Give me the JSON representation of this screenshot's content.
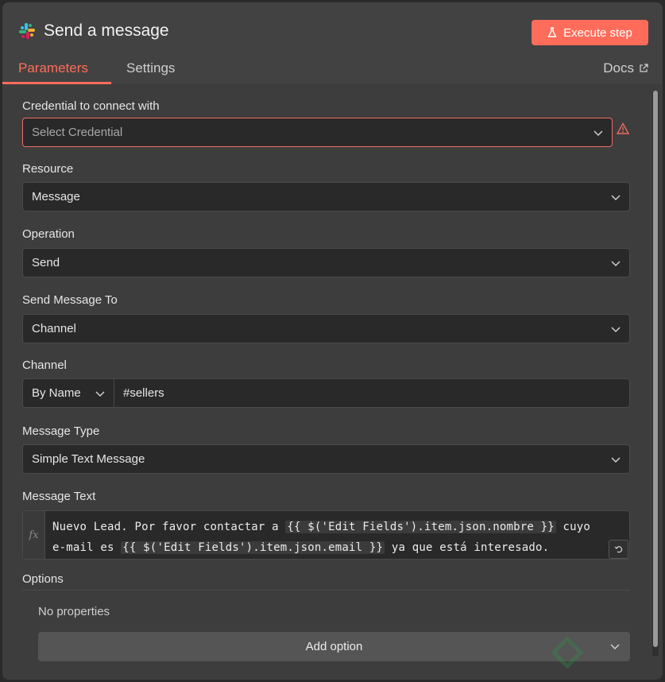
{
  "header": {
    "title": "Send a message",
    "execute_label": "Execute step",
    "tabs": [
      {
        "label": "Parameters",
        "active": true
      },
      {
        "label": "Settings",
        "active": false
      }
    ],
    "docs_label": "Docs"
  },
  "form": {
    "credential": {
      "label": "Credential to connect with",
      "placeholder": "Select Credential"
    },
    "resource": {
      "label": "Resource",
      "value": "Message"
    },
    "operation": {
      "label": "Operation",
      "value": "Send"
    },
    "send_to": {
      "label": "Send Message To",
      "value": "Channel"
    },
    "channel": {
      "label": "Channel",
      "mode": "By Name",
      "value": "#sellers"
    },
    "message_type": {
      "label": "Message Type",
      "value": "Simple Text Message"
    },
    "message_text": {
      "label": "Message Text",
      "fx": "fx",
      "line1_prefix": "Nuevo Lead. Por favor contactar a ",
      "line1_expr": "{{ $('Edit Fields').item.json.nombre }}",
      "line1_suffix": " cuyo",
      "line2_prefix": "e-mail es ",
      "line2_expr": "{{ $('Edit Fields').item.json.email }}",
      "line2_suffix": " ya que está interesado."
    },
    "options": {
      "label": "Options",
      "empty_text": "No properties",
      "add_label": "Add option"
    }
  },
  "colors": {
    "accent": "#ff6d5a",
    "error": "#f06a64",
    "panel": "#3f3f3f",
    "input": "#292929"
  },
  "icons": [
    "slack-icon",
    "flask-icon",
    "external-link-icon",
    "chevron-down-icon",
    "warning-icon",
    "expand-icon",
    "n8n-watermark-icon"
  ]
}
